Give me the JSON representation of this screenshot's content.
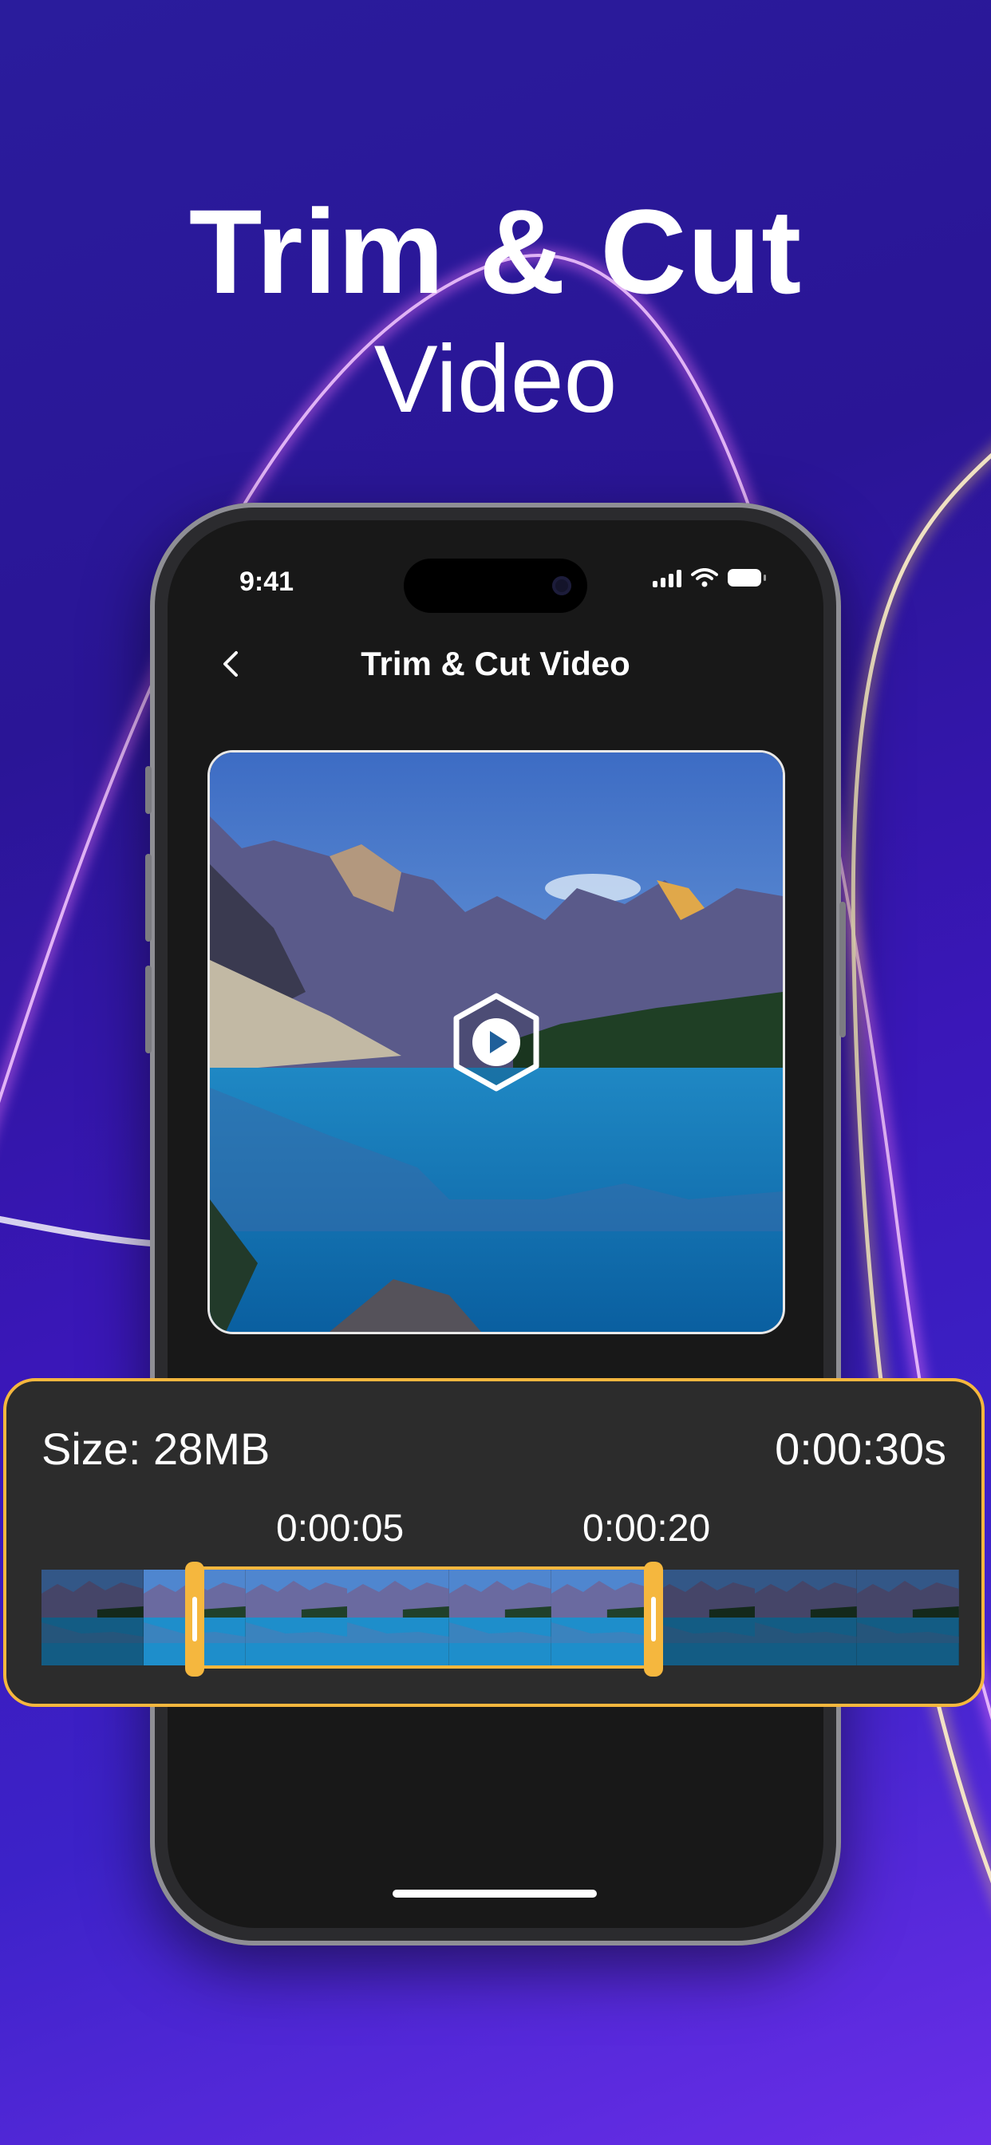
{
  "headline": {
    "line1": "Trim & Cut",
    "line2": "Video"
  },
  "status_bar": {
    "time": "9:41"
  },
  "nav": {
    "title": "Trim & Cut Video",
    "back_icon": "chevron-left-icon"
  },
  "video": {
    "play_icon": "play-icon"
  },
  "trim": {
    "size": "Size: 28MB",
    "duration": "0:00:30s",
    "start_mark": "0:00:05",
    "end_mark": "0:00:20",
    "selected_start_seconds": 5,
    "selected_end_seconds": 20,
    "total_seconds": 30
  },
  "colors": {
    "accent": "#f5b73e",
    "screen_bg": "#181818",
    "card_bg": "#2c2c2c"
  }
}
